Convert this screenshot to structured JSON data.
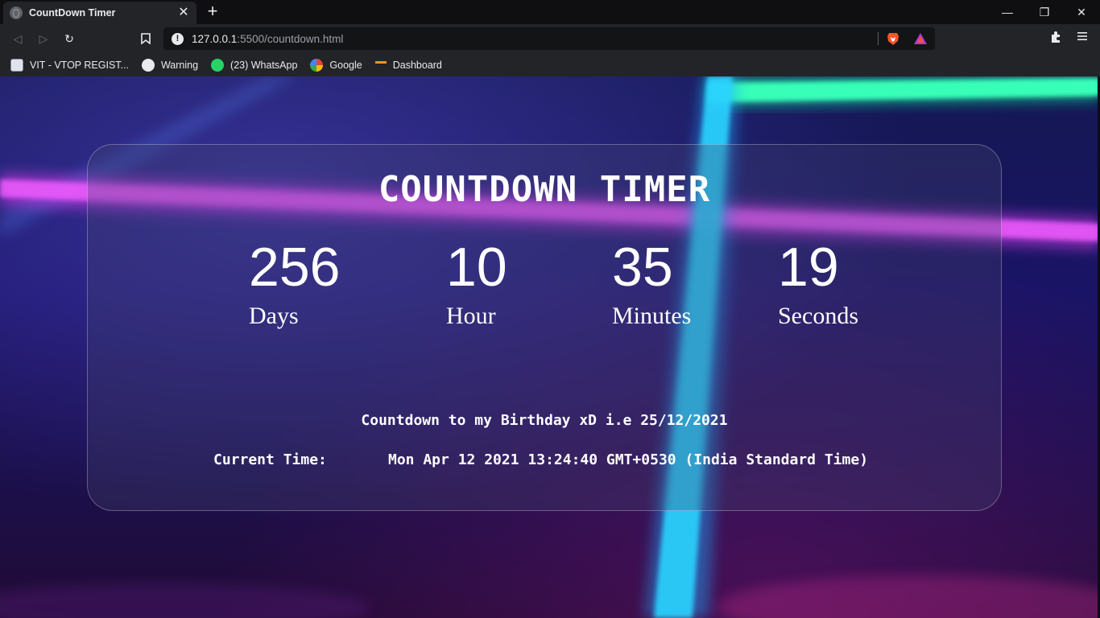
{
  "browser": {
    "tab": {
      "title": "CountDown Timer",
      "close": "✕"
    },
    "new_tab": "+",
    "window_controls": {
      "minimize": "—",
      "restore": "❐",
      "close": "✕"
    },
    "nav": {
      "back": "◁",
      "forward": "▷",
      "reload": "↻",
      "bookmark": "☐"
    },
    "url": {
      "host": "127.0.0.1",
      "rest": ":5500/countdown.html"
    },
    "bookmarks": [
      {
        "label": "VIT - VTOP REGIST...",
        "icon": "vit-icon"
      },
      {
        "label": "Warning",
        "icon": "globe-icon"
      },
      {
        "label": "(23) WhatsApp",
        "icon": "whatsapp-icon"
      },
      {
        "label": "Google",
        "icon": "google-icon"
      },
      {
        "label": "Dashboard",
        "icon": "dashboard-icon"
      }
    ]
  },
  "page": {
    "title": "COUNTDOWN TIMER",
    "units": [
      {
        "value": "256",
        "label": "Days"
      },
      {
        "value": "10",
        "label": "Hour"
      },
      {
        "value": "35",
        "label": "Minutes"
      },
      {
        "value": "19",
        "label": "Seconds"
      }
    ],
    "subtitle": "Countdown to my Birthday xD i.e 25/12/2021",
    "current_time_label": "Current Time:",
    "current_time_value": "Mon Apr 12 2021 13:24:40 GMT+0530 (India Standard Time)"
  },
  "colors": {
    "neon_pink": "#e23cf5",
    "neon_cyan": "#1ec8ff",
    "neon_green": "#10f0a8",
    "chrome_bg": "#232428"
  }
}
